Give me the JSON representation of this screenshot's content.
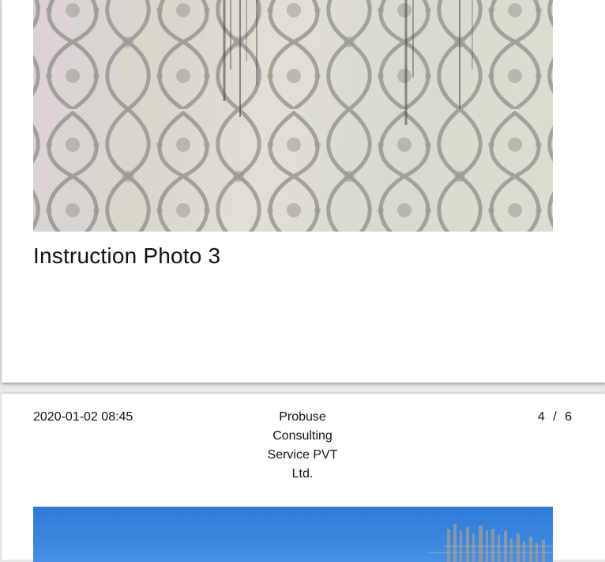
{
  "page_top": {
    "caption": "Instruction Photo 3"
  },
  "page_bottom": {
    "date": "2020-01-02 08:45",
    "company": "Probuse Consulting Service PVT Ltd.",
    "current_page": "4",
    "page_separator": "/",
    "total_pages": "6"
  },
  "colors": {
    "wallpaper_pattern": "#7d7d78",
    "sky_blue": "#3a86e0",
    "page_background": "#ffffff",
    "viewer_background": "#e8e8e8"
  }
}
